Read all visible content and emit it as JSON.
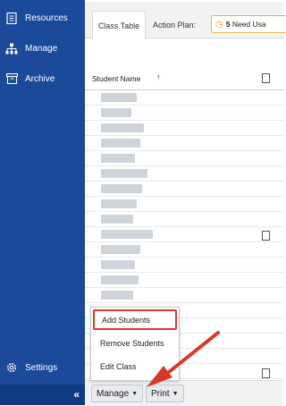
{
  "sidebar": {
    "items": [
      {
        "label": "Resources",
        "icon": "document-icon"
      },
      {
        "label": "Manage",
        "icon": "org-chart-icon"
      },
      {
        "label": "Archive",
        "icon": "archive-box-icon"
      }
    ],
    "settings_label": "Settings",
    "collapse_glyph": "«"
  },
  "tabs": {
    "class_table": "Class Table",
    "action_plan": "Action Plan:",
    "action_count": "5",
    "action_text": "Need Usa"
  },
  "table": {
    "column_header": "Student Name",
    "sort_glyph": "↑"
  },
  "popup": {
    "items": [
      "Add Students",
      "Remove Students",
      "Edit Class"
    ],
    "selected": "Add Students"
  },
  "bottom": {
    "manage_label": "Manage",
    "print_label": "Print",
    "caret": "▼"
  },
  "colors": {
    "sidebar_bg": "#1b4a9b",
    "highlight": "#d8382b",
    "action_border": "#e4b44a"
  }
}
